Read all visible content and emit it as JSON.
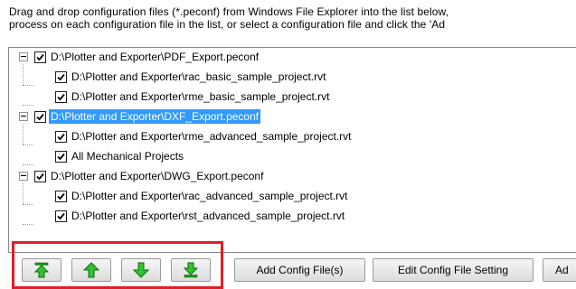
{
  "instructions": {
    "line1": "Drag and drop configuration files (*.peconf) from Windows File Explorer into the list below,",
    "line2": "process on each configuration file in the list, or select a configuration file and click the 'Ad"
  },
  "tree": {
    "groups": [
      {
        "label": "D:\\Plotter and Exporter\\PDF_Export.peconf",
        "checked": true,
        "selected": false,
        "children": [
          "D:\\Plotter and Exporter\\rac_basic_sample_project.rvt",
          "D:\\Plotter and Exporter\\rme_basic_sample_project.rvt"
        ]
      },
      {
        "label": "D:\\Plotter and Exporter\\DXF_Export.peconf",
        "checked": true,
        "selected": true,
        "children": [
          "D:\\Plotter and Exporter\\rme_advanced_sample_project.rvt",
          "All Mechanical Projects"
        ]
      },
      {
        "label": "D:\\Plotter and Exporter\\DWG_Export.peconf",
        "checked": true,
        "selected": false,
        "children": [
          "D:\\Plotter and Exporter\\rac_advanced_sample_project.rvt",
          "D:\\Plotter and Exporter\\rst_advanced_sample_project.rvt"
        ]
      }
    ]
  },
  "toolbar": {
    "move_top_icon": "arrow-up-to-top-icon",
    "move_up_icon": "arrow-up-icon",
    "move_down_icon": "arrow-down-icon",
    "move_bottom_icon": "arrow-down-to-bottom-icon",
    "add_config_label": "Add Config File(s)",
    "edit_config_label": "Edit Config File Setting",
    "add_partial_label": "Ad"
  },
  "colors": {
    "selection": "#3399ff",
    "arrow_green": "#2fc42f",
    "highlight_red": "#e11d27"
  }
}
